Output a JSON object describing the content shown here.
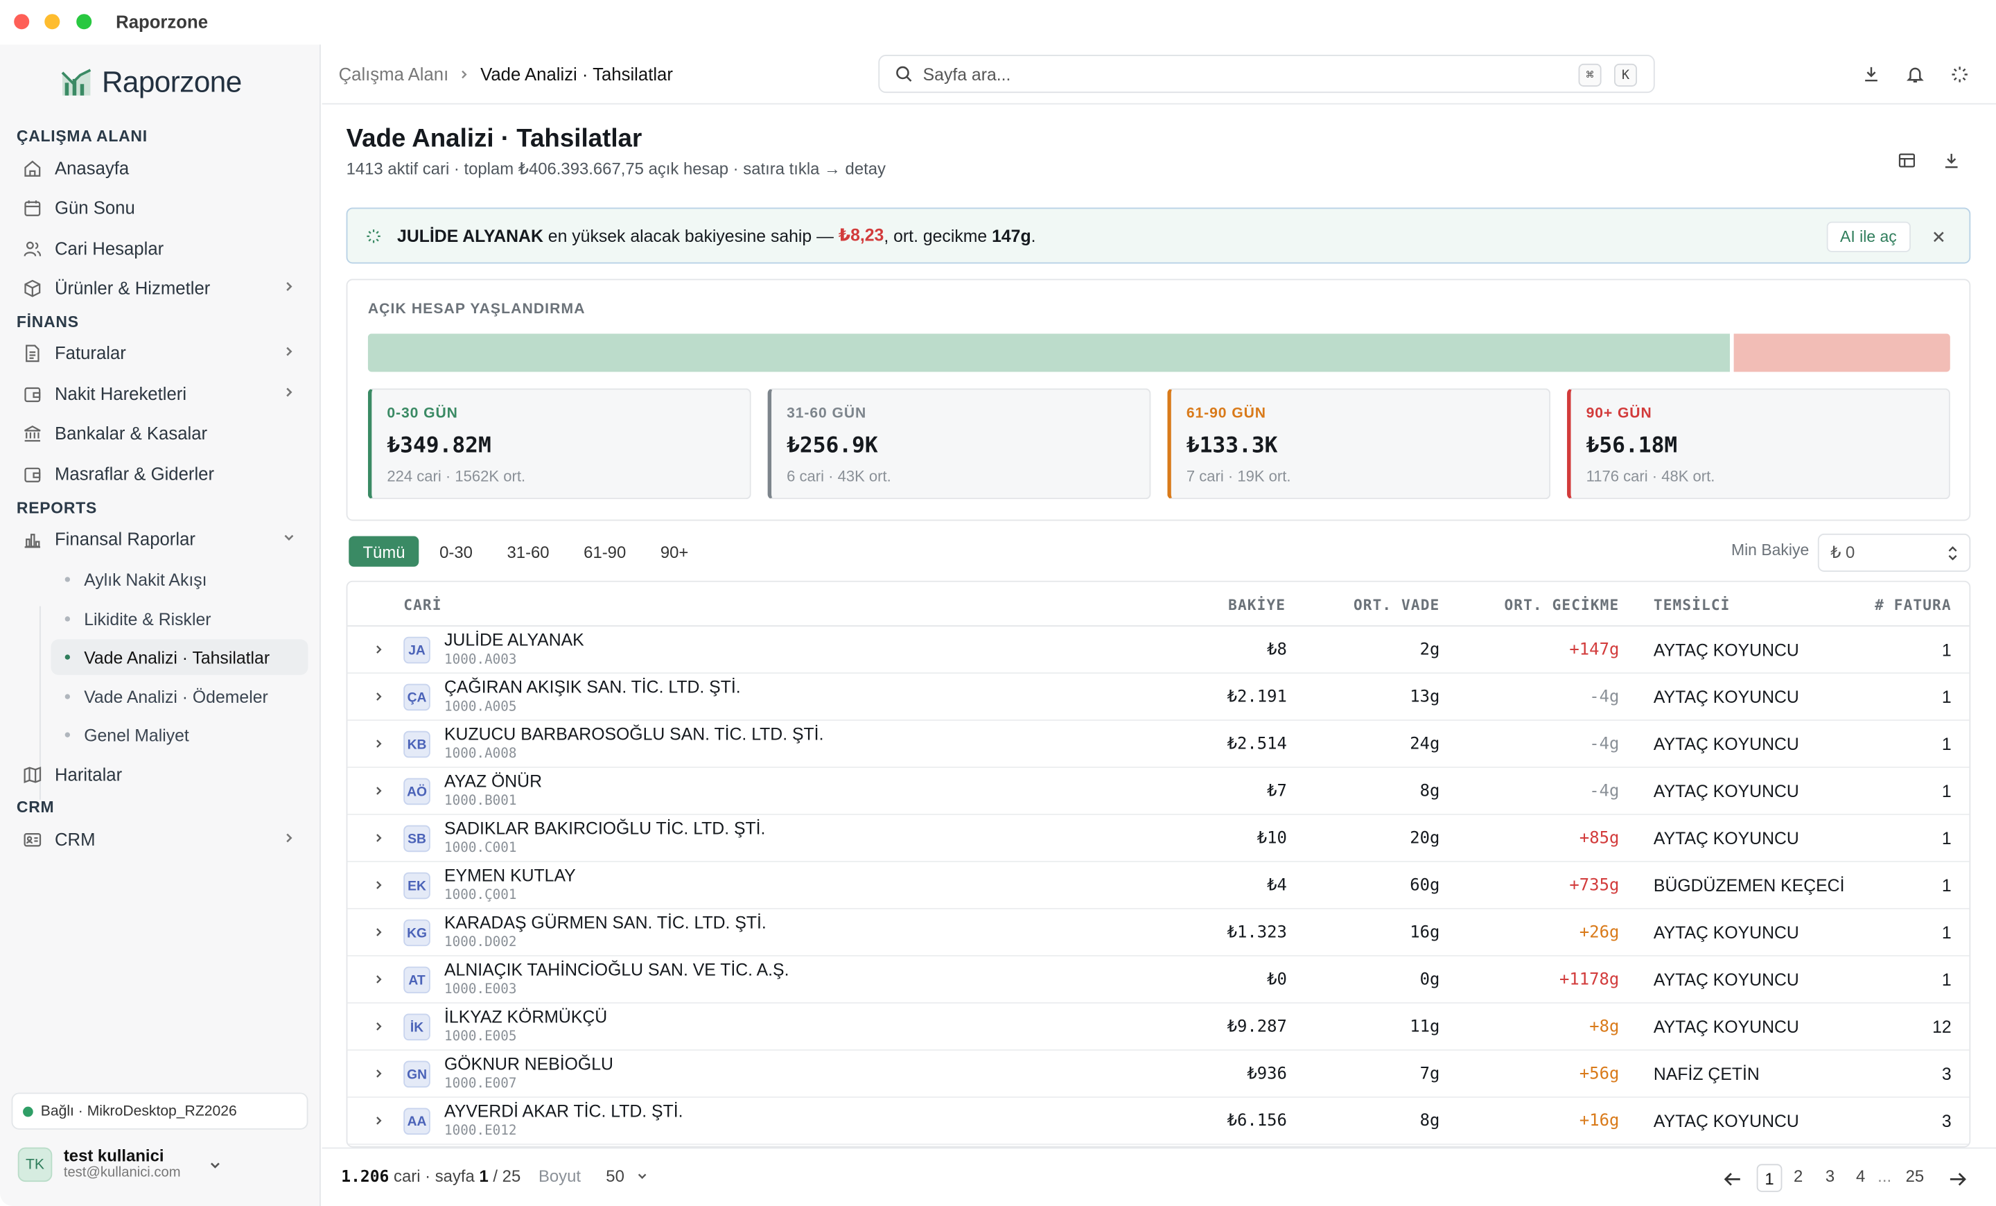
{
  "window": {
    "title": "Raporzone"
  },
  "sidebar": {
    "brand": "Raporzone",
    "sections": [
      "ÇALIŞMA ALANI",
      "FİNANS",
      "REPORTS",
      "CRM"
    ],
    "items": [
      {
        "label": "Anasayfa",
        "icon": "home-icon"
      },
      {
        "label": "Gün Sonu",
        "icon": "calendar-icon"
      },
      {
        "label": "Cari Hesaplar",
        "icon": "users-icon"
      },
      {
        "label": "Ürünler & Hizmetler",
        "icon": "box-icon"
      },
      {
        "label": "Faturalar",
        "icon": "file-icon"
      },
      {
        "label": "Nakit Hareketleri",
        "icon": "wallet-icon"
      },
      {
        "label": "Bankalar & Kasalar",
        "icon": "bank-icon"
      },
      {
        "label": "Masraflar & Giderler",
        "icon": "wallet-icon"
      },
      {
        "label": "Finansal Raporlar",
        "icon": "chart-icon"
      },
      {
        "label": "Haritalar",
        "icon": "map-icon"
      },
      {
        "label": "CRM",
        "icon": "crm-icon"
      }
    ],
    "subitems": [
      "Aylık Nakit Akışı",
      "Likidite & Riskler",
      "Vade Analizi · Tahsilatlar",
      "Vade Analizi · Ödemeler",
      "Genel Maliyet"
    ],
    "connection": "Bağlı · MikroDesktop_RZ2026",
    "user": {
      "initials": "TK",
      "name": "test kullanici",
      "email": "test@kullanici.com"
    }
  },
  "topbar": {
    "breadcrumb_root": "Çalışma Alanı",
    "breadcrumb_current": "Vade Analizi · Tahsilatlar",
    "search_placeholder": "Sayfa ara...",
    "kbd1": "⌘",
    "kbd2": "K"
  },
  "page": {
    "title": "Vade Analizi · Tahsilatlar",
    "subtitle": "1413 aktif cari · toplam ₺406.393.667,75 açık hesap · satıra tıkla → detay"
  },
  "alert": {
    "name": "JULİDE ALYANAK",
    "text1": "en yüksek alacak bakiyesine sahip —",
    "amount": "₺8,23",
    "text2": ", ort. gecikme",
    "delay": "147g",
    "text3": ".",
    "ai_button": "AI ile aç"
  },
  "aging": {
    "title": "AÇIK HESAP YAŞLANDIRMA",
    "bar_fractions": {
      "green": 0.861,
      "red": 0.139
    },
    "cards": [
      {
        "label": "0-30 GÜN",
        "amount": "₺349.82M",
        "meta": "224 cari · 1562K ort.",
        "color": "#3a8a64"
      },
      {
        "label": "31-60 GÜN",
        "amount": "₺256.9K",
        "meta": "6 cari · 43K ort.",
        "color": "#7d858c"
      },
      {
        "label": "61-90 GÜN",
        "amount": "₺133.3K",
        "meta": "7 cari · 19K ort.",
        "color": "#d97a1a"
      },
      {
        "label": "90+ GÜN",
        "amount": "₺56.18M",
        "meta": "1176 cari · 48K ort.",
        "color": "#d23b3b"
      }
    ]
  },
  "filters": {
    "tabs": [
      "Tümü",
      "0-30",
      "31-60",
      "61-90",
      "90+"
    ],
    "active": "Tümü",
    "min_label": "Min Bakiye",
    "min_value": "₺ 0"
  },
  "table": {
    "headers": {
      "cari": "CARİ",
      "bakiye": "BAKİYE",
      "vade": "ORT. VADE",
      "gecikme": "ORT. GECİKME",
      "temsilci": "TEMSİLCİ",
      "fatura": "# FATURA"
    },
    "rows": [
      {
        "initials": "JA",
        "name": "JULİDE ALYANAK",
        "code": "1000.A003",
        "bakiye": "₺8",
        "vade": "2g",
        "gecikme": "+147g",
        "gcolor": "#d23b3b",
        "rep": "AYTAÇ KOYUNCU",
        "fatura": "1"
      },
      {
        "initials": "ÇA",
        "name": "ÇAĞIRAN AKIŞIK SAN. TİC. LTD. ŞTİ.",
        "code": "1000.A005",
        "bakiye": "₺2.191",
        "vade": "13g",
        "gecikme": "-4g",
        "gcolor": "#8a9097",
        "rep": "AYTAÇ KOYUNCU",
        "fatura": "1"
      },
      {
        "initials": "KB",
        "name": "KUZUCU BARBAROSOĞLU SAN. TİC. LTD. ŞTİ.",
        "code": "1000.A008",
        "bakiye": "₺2.514",
        "vade": "24g",
        "gecikme": "-4g",
        "gcolor": "#8a9097",
        "rep": "AYTAÇ KOYUNCU",
        "fatura": "1"
      },
      {
        "initials": "AÖ",
        "name": "AYAZ ÖNÜR",
        "code": "1000.B001",
        "bakiye": "₺7",
        "vade": "8g",
        "gecikme": "-4g",
        "gcolor": "#8a9097",
        "rep": "AYTAÇ KOYUNCU",
        "fatura": "1"
      },
      {
        "initials": "SB",
        "name": "SADIKLAR BAKIRCIOĞLU TİC. LTD. ŞTİ.",
        "code": "1000.C001",
        "bakiye": "₺10",
        "vade": "20g",
        "gecikme": "+85g",
        "gcolor": "#d23b3b",
        "rep": "AYTAÇ KOYUNCU",
        "fatura": "1"
      },
      {
        "initials": "EK",
        "name": "EYMEN KUTLAY",
        "code": "1000.Ç001",
        "bakiye": "₺4",
        "vade": "60g",
        "gecikme": "+735g",
        "gcolor": "#d23b3b",
        "rep": "BÜGDÜZEMEN KEÇECİ",
        "fatura": "1"
      },
      {
        "initials": "KG",
        "name": "KARADAŞ GÜRMEN SAN. TİC. LTD. ŞTİ.",
        "code": "1000.D002",
        "bakiye": "₺1.323",
        "vade": "16g",
        "gecikme": "+26g",
        "gcolor": "#d97a1a",
        "rep": "AYTAÇ KOYUNCU",
        "fatura": "1"
      },
      {
        "initials": "AT",
        "name": "ALNIAÇIK TAHİNCİOĞLU SAN. VE TİC. A.Ş.",
        "code": "1000.E003",
        "bakiye": "₺0",
        "vade": "0g",
        "gecikme": "+1178g",
        "gcolor": "#d23b3b",
        "rep": "AYTAÇ KOYUNCU",
        "fatura": "1"
      },
      {
        "initials": "İK",
        "name": "İLKYAZ KÖRMÜKÇÜ",
        "code": "1000.E005",
        "bakiye": "₺9.287",
        "vade": "11g",
        "gecikme": "+8g",
        "gcolor": "#d97a1a",
        "rep": "AYTAÇ KOYUNCU",
        "fatura": "12"
      },
      {
        "initials": "GN",
        "name": "GÖKNUR NEBİOĞLU",
        "code": "1000.E007",
        "bakiye": "₺936",
        "vade": "7g",
        "gecikme": "+56g",
        "gcolor": "#d97a1a",
        "rep": "NAFİZ ÇETİN",
        "fatura": "3"
      },
      {
        "initials": "AA",
        "name": "AYVERDİ AKAR TİC. LTD. ŞTİ.",
        "code": "1000.E012",
        "bakiye": "₺6.156",
        "vade": "8g",
        "gecikme": "+16g",
        "gcolor": "#d97a1a",
        "rep": "AYTAÇ KOYUNCU",
        "fatura": "3"
      }
    ]
  },
  "footer": {
    "count": "1.206",
    "cari": "cari · sayfa",
    "page": "1",
    "slash": "/ 25",
    "size_label": "Boyut",
    "size": "50",
    "pages": [
      "1",
      "2",
      "3",
      "4"
    ],
    "ellipsis": "...",
    "last": "25"
  }
}
